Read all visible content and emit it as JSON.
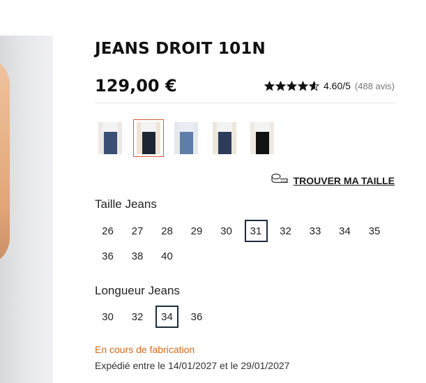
{
  "product": {
    "title": "JEANS DROIT 101N",
    "price": "129,00 €"
  },
  "rating": {
    "score": "4.60/5",
    "count": "(488 avis)",
    "stars_value": 4.6,
    "stars_max": 5
  },
  "thumbnails": [
    {
      "name": "thumb-1",
      "selected": false,
      "bg": "#ece8e4",
      "jean": "#3a4f73"
    },
    {
      "name": "thumb-2",
      "selected": true,
      "bg": "#efe3d5",
      "jean": "#1f2633"
    },
    {
      "name": "thumb-3",
      "selected": false,
      "bg": "#e4e8ec",
      "jean": "#5d7ea8"
    },
    {
      "name": "thumb-4",
      "selected": false,
      "bg": "#ece6dc",
      "jean": "#2d3c5a"
    },
    {
      "name": "thumb-5",
      "selected": false,
      "bg": "#eee9e2",
      "jean": "#121212"
    }
  ],
  "find_size": {
    "label": "TROUVER MA TAILLE",
    "icon": "measuring-tape-icon"
  },
  "waist": {
    "title": "Taille Jeans",
    "sizes": [
      "26",
      "27",
      "28",
      "29",
      "30",
      "31",
      "32",
      "33",
      "34",
      "35",
      "36",
      "38",
      "40"
    ],
    "selected": "31"
  },
  "length": {
    "title": "Longueur Jeans",
    "sizes": [
      "30",
      "32",
      "34",
      "36"
    ],
    "selected": "34"
  },
  "availability": {
    "status": "En cours de fabrication",
    "shipping": "Expédié entre le 14/01/2027 et le 29/01/2027"
  },
  "colors": {
    "accent": "#d6691f",
    "selected_border": "#1c2b3a",
    "thumb_selected": "#d35a3a",
    "star": "#111111"
  }
}
